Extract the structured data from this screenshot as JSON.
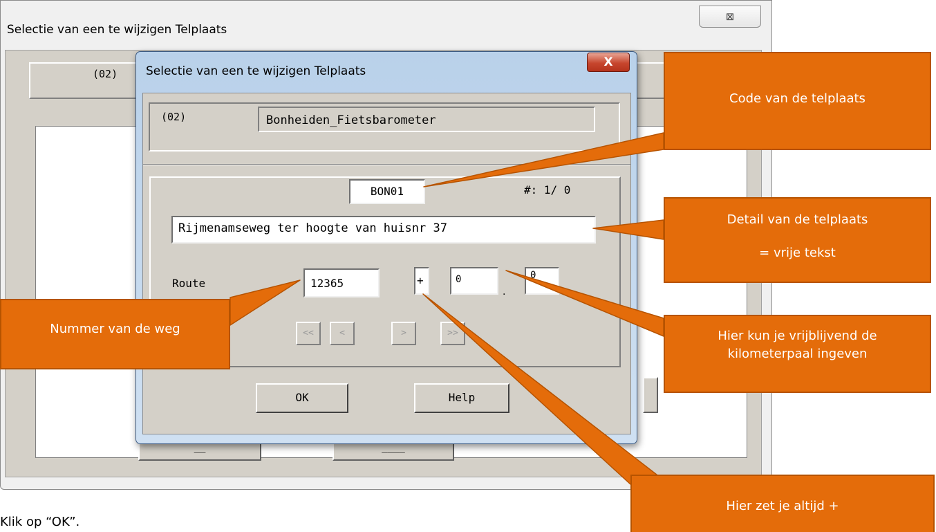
{
  "outer_window": {
    "title": "Selectie van een te wijzigen Telplaats",
    "close_glyph": "⊠",
    "code": "(02)",
    "button1": "__",
    "button2": "____"
  },
  "dialog": {
    "title": "Selectie van een te wijzigen Telplaats",
    "close_glyph": "X",
    "code": "(02)",
    "name": "Bonheiden_Fietsbarometer",
    "telplaats_code": "BON01",
    "counter": "#:  1/  0",
    "detail": "Rijmenamseweg ter hoogte van huisnr 37",
    "route_label": "Route",
    "route_value": "12365",
    "sign_value": "+",
    "km_value": "0",
    "km_separator": ".",
    "hm_value": "0",
    "nav": {
      "first": "<<",
      "prev": "<",
      "next": ">",
      "last": ">>"
    },
    "ok_label": "OK",
    "help_label": "Help"
  },
  "callouts": {
    "code": "Code van de telplaats",
    "detail_line1": "Detail van de telplaats",
    "detail_line2": "= vrije tekst",
    "route": "Nummer van de weg",
    "km_line1": "Hier kun je vrijblijvend de",
    "km_line2": "kilometerpaal ingeven",
    "sign": "Hier zet je altijd +"
  },
  "callout_color": "#e46c0a",
  "caption": "Klik op “OK”."
}
